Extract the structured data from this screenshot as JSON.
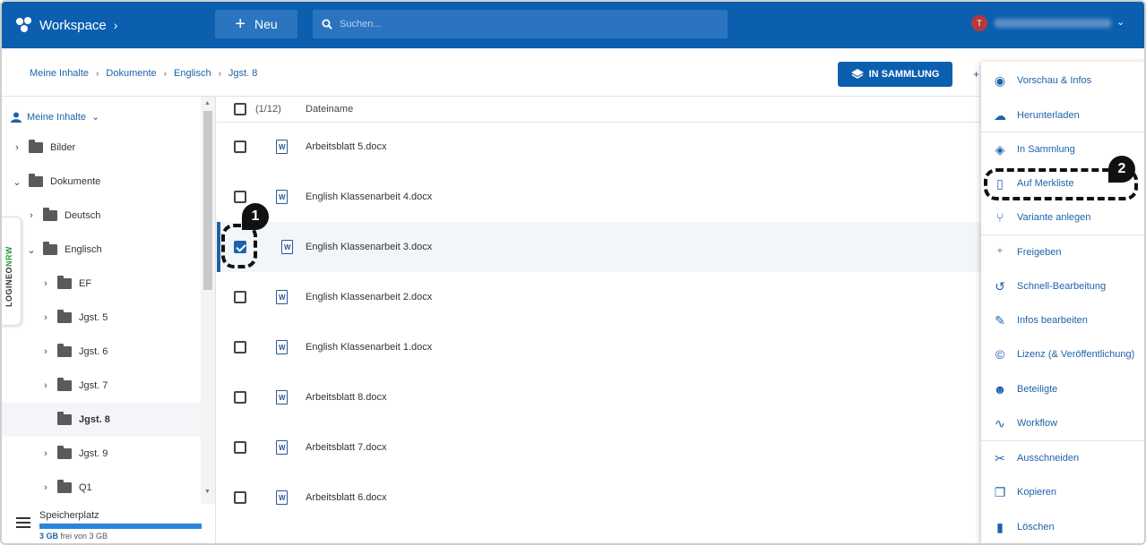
{
  "header": {
    "brand": "Workspace",
    "new_label": "Neu",
    "search_placeholder": "Suchen...",
    "avatar_letter": "T"
  },
  "breadcrumb": [
    "Meine Inhalte",
    "Dokumente",
    "Englisch",
    "Jgst. 8"
  ],
  "toolbar": {
    "collection_button": "IN SAMMLUNG"
  },
  "sidebar": {
    "root_label": "Meine Inhalte",
    "tree": [
      {
        "label": "Bilder",
        "level": 0,
        "arrow": "›"
      },
      {
        "label": "Dokumente",
        "level": 0,
        "arrow": "⌄"
      },
      {
        "label": "Deutsch",
        "level": 1,
        "arrow": "›"
      },
      {
        "label": "Englisch",
        "level": 1,
        "arrow": "⌄"
      },
      {
        "label": "EF",
        "level": 2,
        "arrow": "›"
      },
      {
        "label": "Jgst. 5",
        "level": 2,
        "arrow": "›"
      },
      {
        "label": "Jgst. 6",
        "level": 2,
        "arrow": "›"
      },
      {
        "label": "Jgst. 7",
        "level": 2,
        "arrow": "›"
      },
      {
        "label": "Jgst. 8",
        "level": 2,
        "arrow": "",
        "active": true
      },
      {
        "label": "Jgst. 9",
        "level": 2,
        "arrow": "›"
      },
      {
        "label": "Q1",
        "level": 2,
        "arrow": "›"
      }
    ],
    "storage": {
      "title": "Speicherplatz",
      "amount": "3 GB",
      "detail": "frei von 3 GB"
    },
    "side_tab": {
      "part1": "LOGINEO",
      "part2": "NRW"
    }
  },
  "list": {
    "count": "(1/12)",
    "column_name": "Dateiname",
    "files": [
      {
        "name": "Arbeitsblatt 5.docx",
        "selected": false
      },
      {
        "name": "English Klassenarbeit 4.docx",
        "selected": false
      },
      {
        "name": "English Klassenarbeit 3.docx",
        "selected": true
      },
      {
        "name": "English Klassenarbeit 2.docx",
        "selected": false
      },
      {
        "name": "English Klassenarbeit 1.docx",
        "selected": false
      },
      {
        "name": "Arbeitsblatt 8.docx",
        "selected": false
      },
      {
        "name": "Arbeitsblatt 7.docx",
        "selected": false
      },
      {
        "name": "Arbeitsblatt 6.docx",
        "selected": false
      }
    ]
  },
  "context_menu": [
    {
      "label": "Vorschau & Infos",
      "icon": "eye-icon"
    },
    {
      "label": "Herunterladen",
      "icon": "cloud-download-icon"
    },
    {
      "label": "In Sammlung",
      "icon": "layers-icon"
    },
    {
      "label": "Auf Merkliste",
      "icon": "bookmark-icon"
    },
    {
      "label": "Variante anlegen",
      "icon": "fork-icon"
    },
    {
      "label": "Freigeben",
      "icon": "share-people-icon"
    },
    {
      "label": "Schnell-Bearbeitung",
      "icon": "history-icon"
    },
    {
      "label": "Infos bearbeiten",
      "icon": "pencil-icon"
    },
    {
      "label": "Lizenz (& Veröffentlichung)",
      "icon": "copyright-icon"
    },
    {
      "label": "Beteiligte",
      "icon": "people-icon"
    },
    {
      "label": "Workflow",
      "icon": "workflow-icon"
    },
    {
      "label": "Ausschneiden",
      "icon": "scissors-icon"
    },
    {
      "label": "Kopieren",
      "icon": "copy-icon"
    },
    {
      "label": "Löschen",
      "icon": "trash-icon"
    }
  ],
  "annotations": [
    "1",
    "2"
  ]
}
